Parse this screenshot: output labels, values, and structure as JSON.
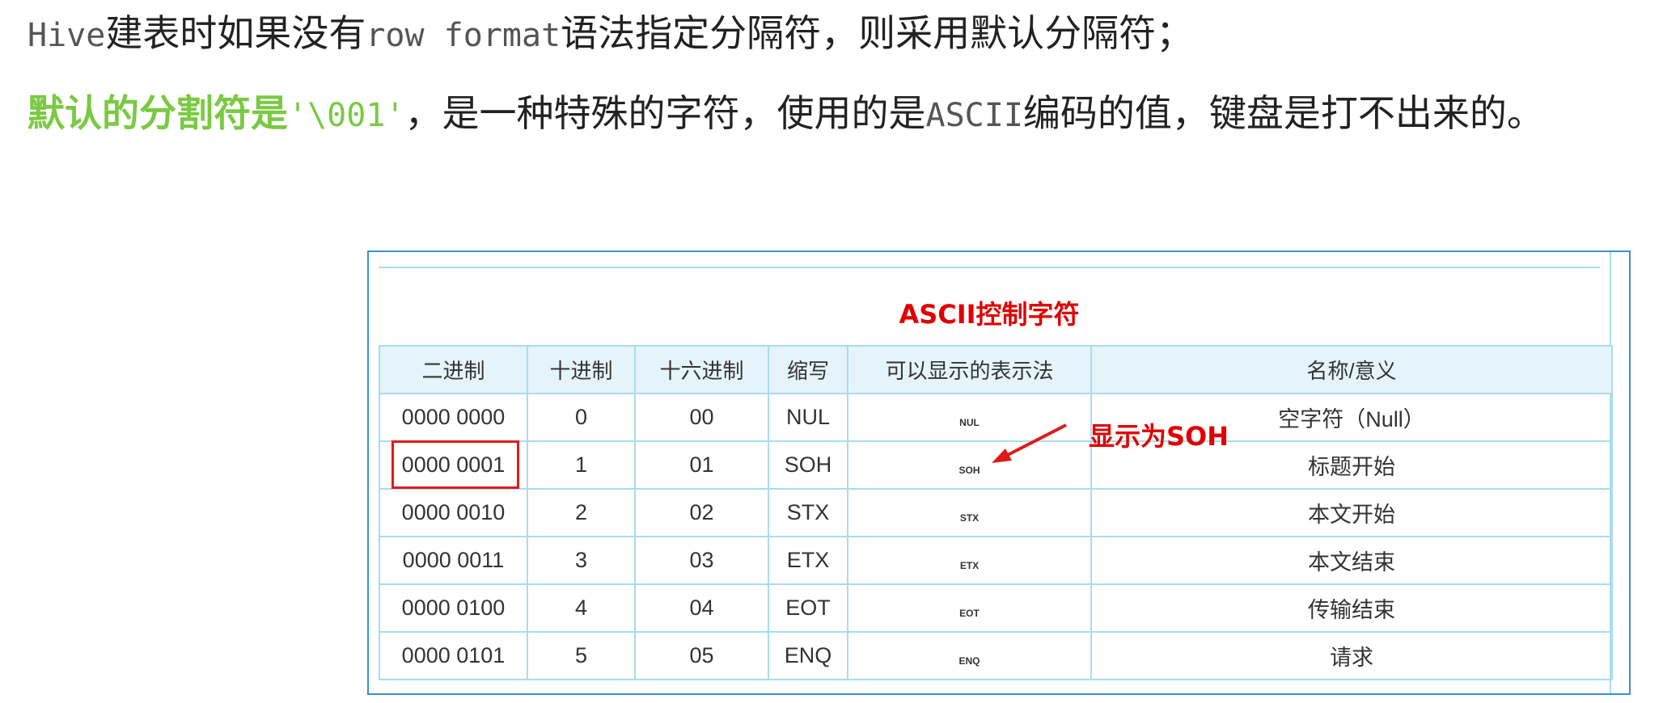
{
  "paragraph1": {
    "text_a": "Hive",
    "text_b": "建表时如果没有",
    "text_c": "row format",
    "text_d": "语法指定分隔符，则采用默认分隔符；"
  },
  "paragraph2": {
    "highlight": "默认的分割符是",
    "code": "'\\001'",
    "text_a": "，是一种特殊的字符，使用的是",
    "ascii_word": "ASCII",
    "text_b": "编码的值，键盘是打不出来的。"
  },
  "table": {
    "title": "ASCII控制字符",
    "headers": [
      "二进制",
      "十进制",
      "十六进制",
      "缩写",
      "可以显示的表示法",
      "名称/意义"
    ],
    "rows": [
      [
        "0000 0000",
        "0",
        "00",
        "NUL",
        "NUL",
        "空字符（Null）"
      ],
      [
        "0000 0001",
        "1",
        "01",
        "SOH",
        "SOH",
        "标题开始"
      ],
      [
        "0000 0010",
        "2",
        "02",
        "STX",
        "STX",
        "本文开始"
      ],
      [
        "0000 0011",
        "3",
        "03",
        "ETX",
        "ETX",
        "本文结束"
      ],
      [
        "0000 0100",
        "4",
        "04",
        "EOT",
        "EOT",
        "传输结束"
      ],
      [
        "0000 0101",
        "5",
        "05",
        "ENQ",
        "ENQ",
        "请求"
      ]
    ]
  },
  "annotation": "显示为SOH",
  "colors": {
    "accent_green": "#7ac943",
    "annotation_red": "#e00000",
    "table_border": "#a9dcf0"
  }
}
